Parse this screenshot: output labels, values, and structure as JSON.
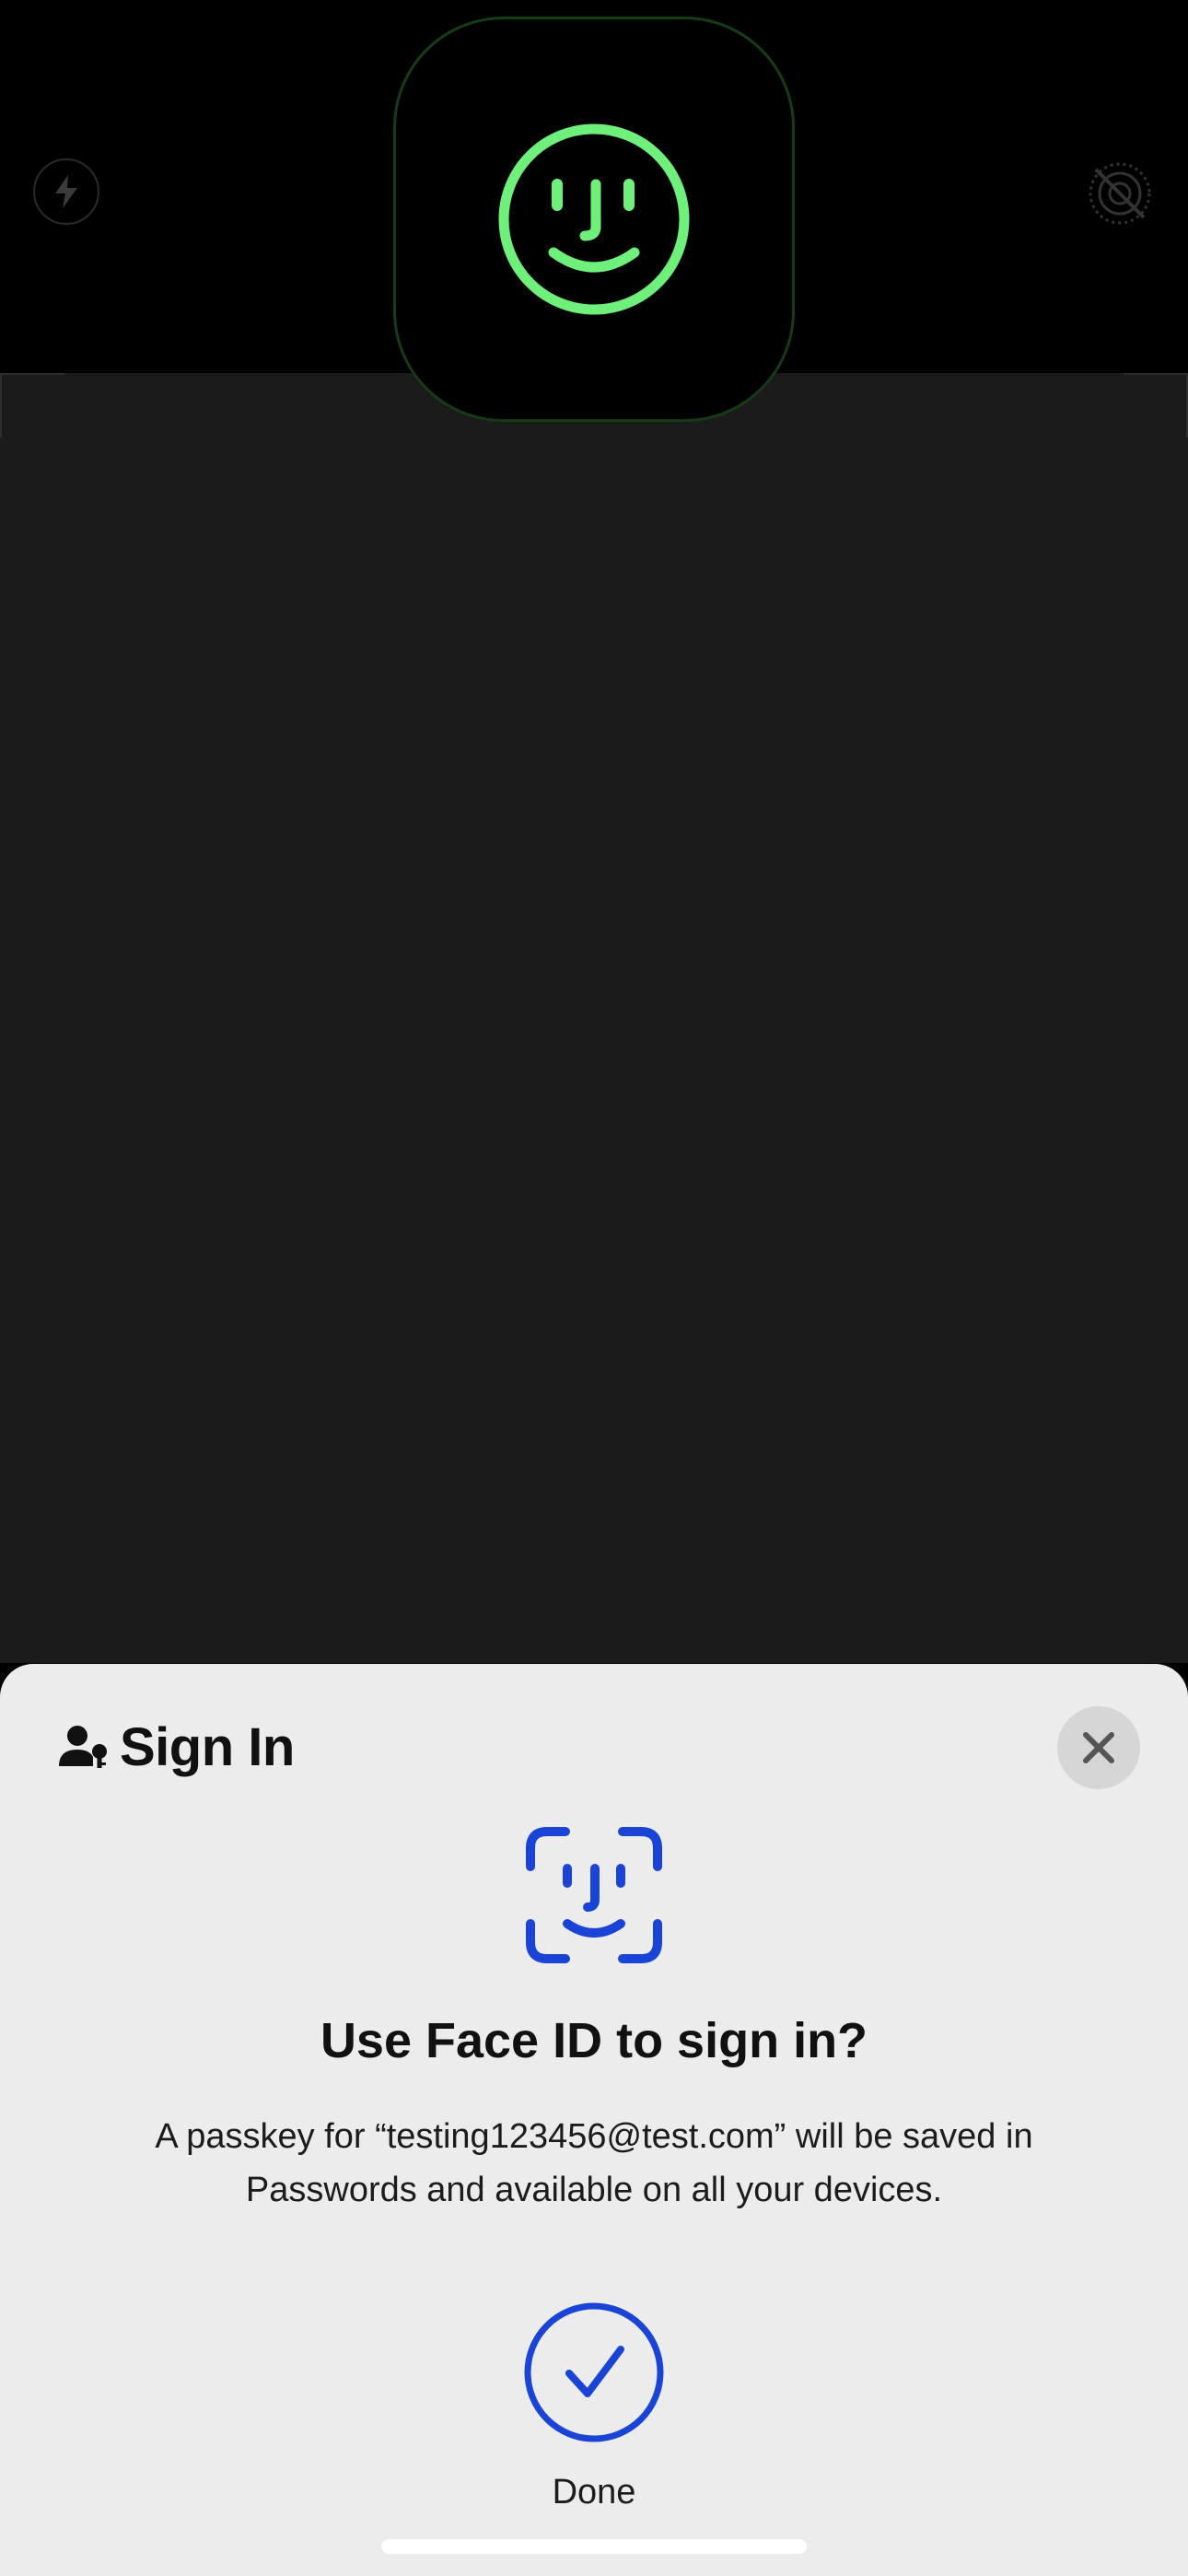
{
  "colors": {
    "accent_blue": "#1a44d6",
    "faceid_green": "#6ff07a",
    "sheet_bg": "#ececec"
  },
  "icons": {
    "flash": "flash-bolt-icon",
    "live_photo": "live-photo-off-icon",
    "hud": "face-id-success-icon",
    "header": "person-key-icon",
    "close": "close-icon",
    "face_id": "face-id-icon",
    "done": "checkmark-circle-icon"
  },
  "sheet": {
    "title": "Sign In",
    "prompt_title": "Use Face ID to sign in?",
    "body_prefix": "A passkey for “",
    "account": "testing123456@test.com",
    "body_suffix": "” will be saved in Passwords and available on all your devices.",
    "done_label": "Done"
  }
}
